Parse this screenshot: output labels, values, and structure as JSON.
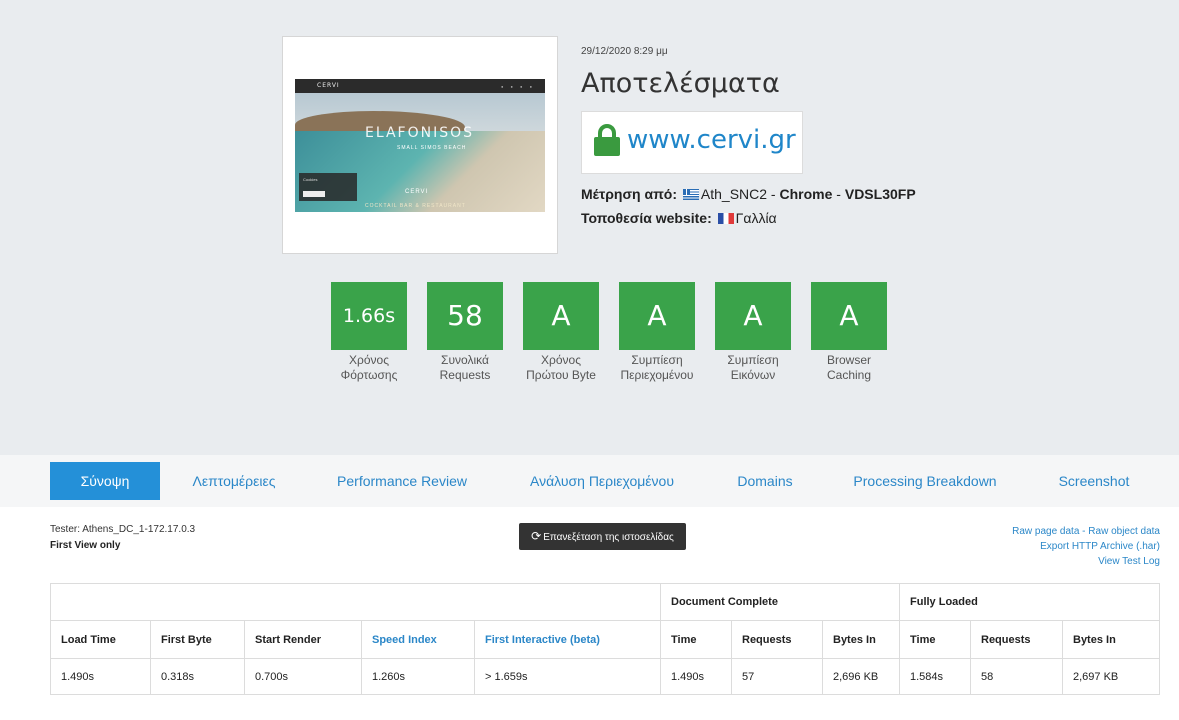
{
  "header": {
    "date": "29/12/2020 8:29 μμ",
    "title": "Αποτελέσματα",
    "url": "www.cervi.gr",
    "measured_label": "Μέτρηση από:",
    "measured_location": "Ath_SNC2",
    "measured_sep1": " - ",
    "browser": "Chrome",
    "measured_sep2": " - ",
    "connection": "VDSL30FP",
    "website_location_label": "Τοποθεσία website:",
    "website_country": "Γαλλία"
  },
  "thumbnail": {
    "brand": "CERVI",
    "headline": "ELAFONISOS",
    "subheadline": "SMALL SIMOS BEACH",
    "cookie_text": "Cookies",
    "logo": "CERVI",
    "tagline": "COCKTAIL BAR & RESTAURANT"
  },
  "grades": [
    {
      "value": "1.66s",
      "label_line1": "Χρόνος",
      "label_line2": "Φόρτωσης"
    },
    {
      "value": "58",
      "label_line1": "Συνολικά",
      "label_line2": "Requests"
    },
    {
      "value": "A",
      "label_line1": "Χρόνος",
      "label_line2": "Πρώτου Byte"
    },
    {
      "value": "A",
      "label_line1": "Συμπίεση",
      "label_line2": "Περιεχομένου"
    },
    {
      "value": "A",
      "label_line1": "Συμπίεση",
      "label_line2": "Εικόνων"
    },
    {
      "value": "A",
      "label_line1": "Browser",
      "label_line2": "Caching"
    }
  ],
  "grade_color": "#3aa34a",
  "tabs": [
    {
      "label": "Σύνοψη",
      "active": true
    },
    {
      "label": "Λεπτομέρειες",
      "active": false
    },
    {
      "label": "Performance Review",
      "active": false
    },
    {
      "label": "Ανάλυση Περιεχομένου",
      "active": false
    },
    {
      "label": "Domains",
      "active": false
    },
    {
      "label": "Processing Breakdown",
      "active": false
    },
    {
      "label": "Screenshot",
      "active": false
    }
  ],
  "test_info": {
    "tester": "Tester: Athens_DC_1-172.17.0.3",
    "view": "First View only",
    "retest_label": "Επανεξέταση της ιστοσελίδας",
    "raw_page_data": "Raw page data",
    "link_sep": " - ",
    "raw_object_data": "Raw object data",
    "export_har": "Export HTTP Archive (.har)",
    "view_test_log": "View Test Log"
  },
  "table": {
    "group_headers": {
      "document_complete": "Document Complete",
      "fully_loaded": "Fully Loaded"
    },
    "columns": [
      "Load Time",
      "First Byte",
      "Start Render",
      "Speed Index",
      "First Interactive (beta)",
      "Time",
      "Requests",
      "Bytes In",
      "Time",
      "Requests",
      "Bytes In"
    ],
    "row": [
      "1.490s",
      "0.318s",
      "0.700s",
      "1.260s",
      "> 1.659s",
      "1.490s",
      "57",
      "2,696 KB",
      "1.584s",
      "58",
      "2,697 KB"
    ]
  }
}
